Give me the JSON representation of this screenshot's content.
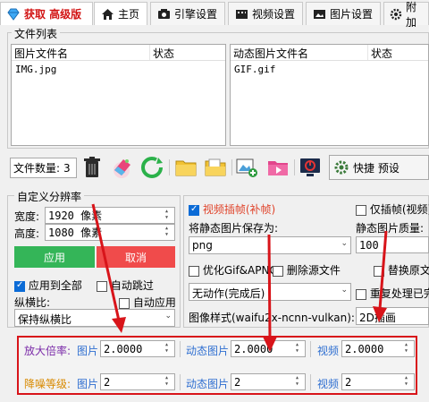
{
  "tabs": [
    {
      "label": "获取 高级版",
      "icon": "diamond-icon"
    },
    {
      "label": "主页",
      "icon": "home-icon"
    },
    {
      "label": "引擎设置",
      "icon": "engine-icon"
    },
    {
      "label": "视频设置",
      "icon": "film-icon"
    },
    {
      "label": "图片设置",
      "icon": "image-icon"
    },
    {
      "label": "附加",
      "icon": "gear-icon"
    }
  ],
  "file_list": {
    "legend": "文件列表",
    "left": {
      "col_name": "图片文件名",
      "col_status": "状态",
      "rows": [
        "IMG.jpg"
      ]
    },
    "right": {
      "col_name": "动态图片文件名",
      "col_status": "状态",
      "rows": [
        "GIF.gif"
      ]
    }
  },
  "toolbar": {
    "file_count_label": "文件数量:",
    "file_count": "3",
    "shortcut_label": "快捷 预设"
  },
  "custom_res": {
    "legend": "自定义分辨率",
    "width_label": "宽度:",
    "width_value": "1920 像素",
    "height_label": "高度:",
    "height_value": "1080 像素",
    "apply": "应用",
    "cancel": "取消",
    "apply_all": "应用到全部",
    "auto_skip": "自动跳过",
    "aspect_label": "纵横比:",
    "auto_apply": "自动应用",
    "aspect_value": "保持纵横比"
  },
  "options": {
    "video_interp": "视频插帧(补帧)",
    "only_interp": "仅插帧(视频)",
    "save_as_label": "将静态图片保存为:",
    "save_as_value": "png",
    "quality_label": "静态图片质量:",
    "quality_value": "100",
    "opt_gif": "优化Gif&APNG",
    "del_source": "删除源文件",
    "replace_orig": "替换原文",
    "no_action": "无动作(完成后)",
    "reprocess": "重复处理已完",
    "style_label": "图像样式(waifu2x-ncnn-vulkan):",
    "style_value": "2D插画"
  },
  "scale_panel": {
    "scale_label": "放大倍率:",
    "denoise_label": "降噪等级:",
    "image_label": "图片",
    "animated_label": "动态图片",
    "video_label": "视频",
    "scale_image": "2.0000",
    "scale_animated": "2.0000",
    "scale_video": "2.0000",
    "denoise_image": "2",
    "denoise_animated": "2",
    "denoise_video": "2"
  },
  "colors": {
    "accent_blue": "#0b6bd6",
    "apply_green": "#34b558",
    "cancel_red": "#f04b4b",
    "annotation_red": "#d8141a",
    "label_orange": "#d88a00",
    "label_purple": "#7a2aa8"
  }
}
